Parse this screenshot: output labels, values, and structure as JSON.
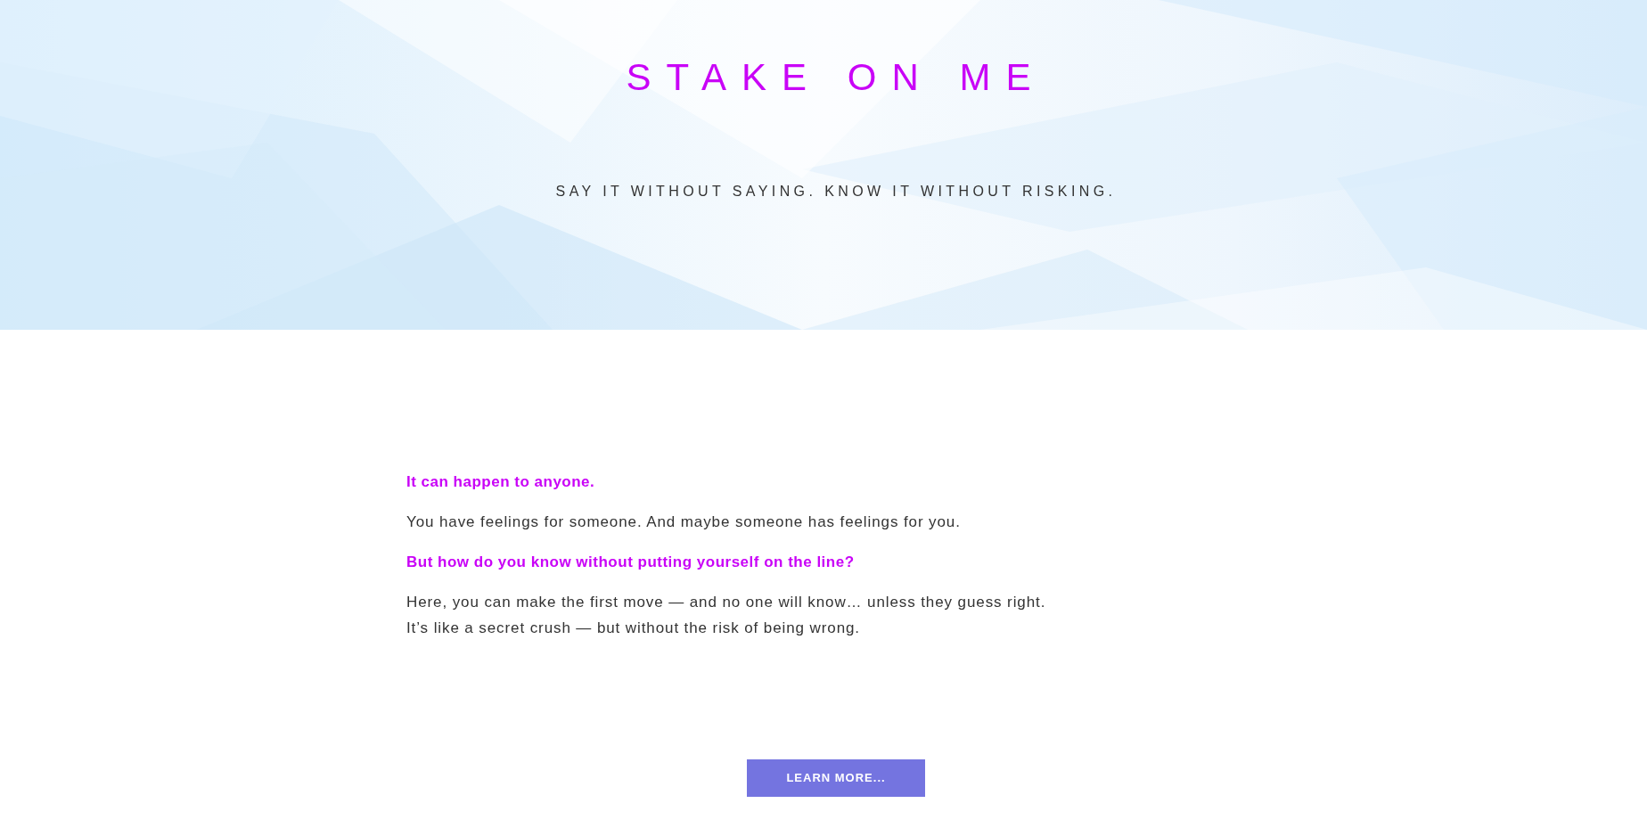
{
  "hero": {
    "title": "STAKE ON ME",
    "tagline": "SAY IT WITHOUT SAYING. KNOW IT WITHOUT RISKING."
  },
  "intro": {
    "paragraphs": [
      {
        "kind": "highlight",
        "lines": [
          "It can happen to anyone."
        ]
      },
      {
        "kind": "body",
        "lines": [
          "You have feelings for someone. And maybe someone has feelings for you."
        ]
      },
      {
        "kind": "highlight",
        "lines": [
          "But how do you know without putting yourself on the line?"
        ]
      },
      {
        "kind": "body",
        "lines": [
          "Here, you can make the first move — and no one will know… unless they guess right.",
          "It’s like a secret crush — but without the risk of being wrong."
        ]
      }
    ]
  },
  "button": {
    "label": "LEARN MORE..."
  }
}
